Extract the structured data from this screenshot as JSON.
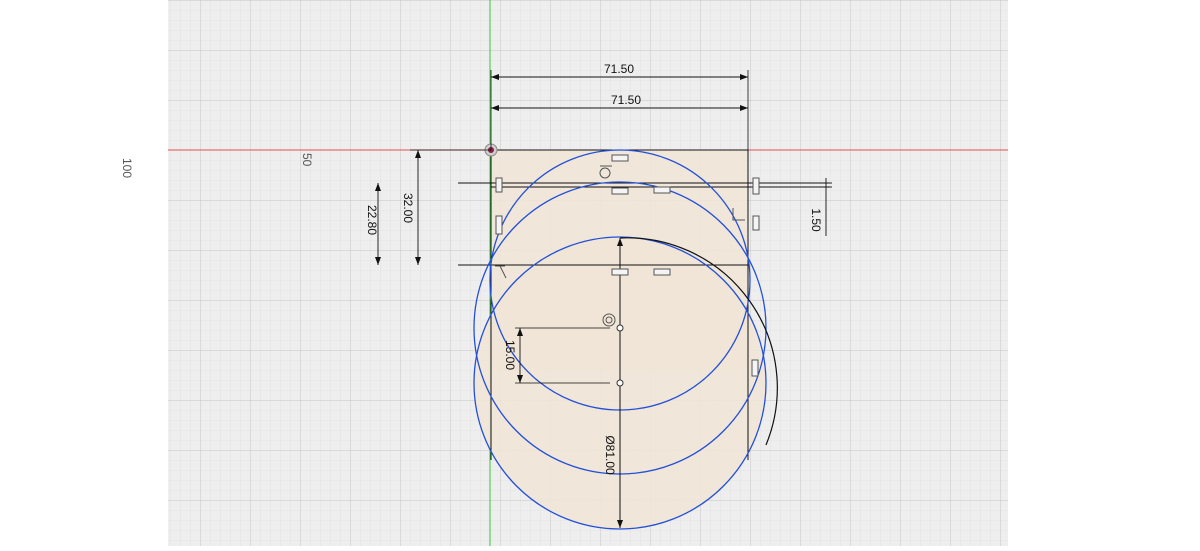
{
  "sketch": {
    "dimensions": {
      "width_top": "71.50",
      "width_second": "71.50",
      "height_outer": "22.80",
      "height_inner": "32.00",
      "offset_small": "1.50",
      "hole_spacing": "15.00",
      "diameter": "Ø81.00"
    },
    "ruler": {
      "label_100": "100",
      "label_50": "50"
    },
    "colors": {
      "background": "#ffffff",
      "grid_bg": "#eeeeee",
      "grid_minor": "#d9d9d9",
      "grid_major": "#c4c4c4",
      "profile_fill": "#efe4d6",
      "circle_blue": "#2450d8",
      "axis_red": "#e05050",
      "axis_green": "#40c040",
      "dimension": "#111111"
    }
  }
}
